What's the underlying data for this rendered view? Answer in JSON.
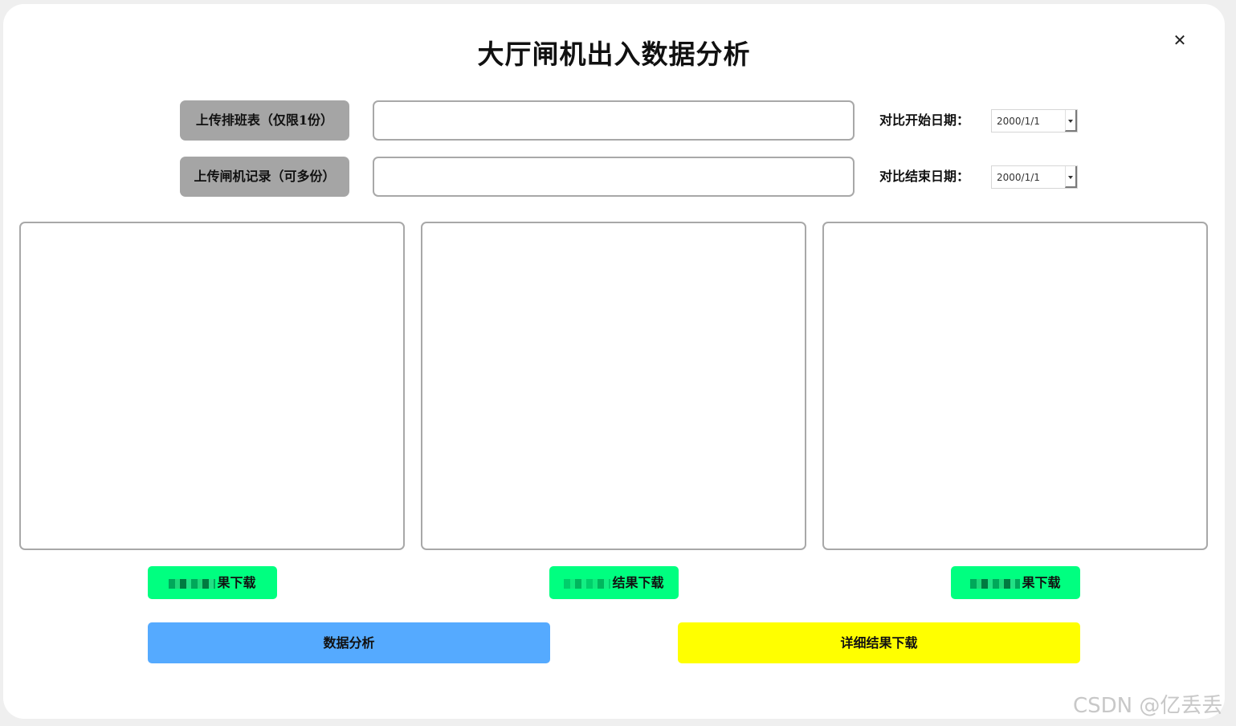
{
  "window": {
    "title": "大厅闸机出入数据分析",
    "close_glyph": "✕"
  },
  "uploads": [
    {
      "label": "上传排班表（仅限1份）",
      "value": ""
    },
    {
      "label": "上传闸机记录（可多份）",
      "value": ""
    }
  ],
  "dates": {
    "start_label": "对比开始日期：",
    "start_value": "2000/1/1",
    "end_label": "对比结束日期：",
    "end_value": "2000/1/1"
  },
  "panels": [
    {
      "content": ""
    },
    {
      "content": ""
    },
    {
      "content": ""
    }
  ],
  "downloads": [
    {
      "visible_label": "果下载"
    },
    {
      "visible_label": "结果下载"
    },
    {
      "visible_label": "果下载"
    }
  ],
  "actions": {
    "analyze_label": "数据分析",
    "detail_download_label": "详细结果下载"
  },
  "watermark": "CSDN @亿丢丢",
  "colors": {
    "upload_button": "#a5a5a5",
    "download_button": "#00ff80",
    "analyze_button": "#55aaff",
    "detail_button": "#ffff00",
    "border": "#a8a8a8"
  }
}
